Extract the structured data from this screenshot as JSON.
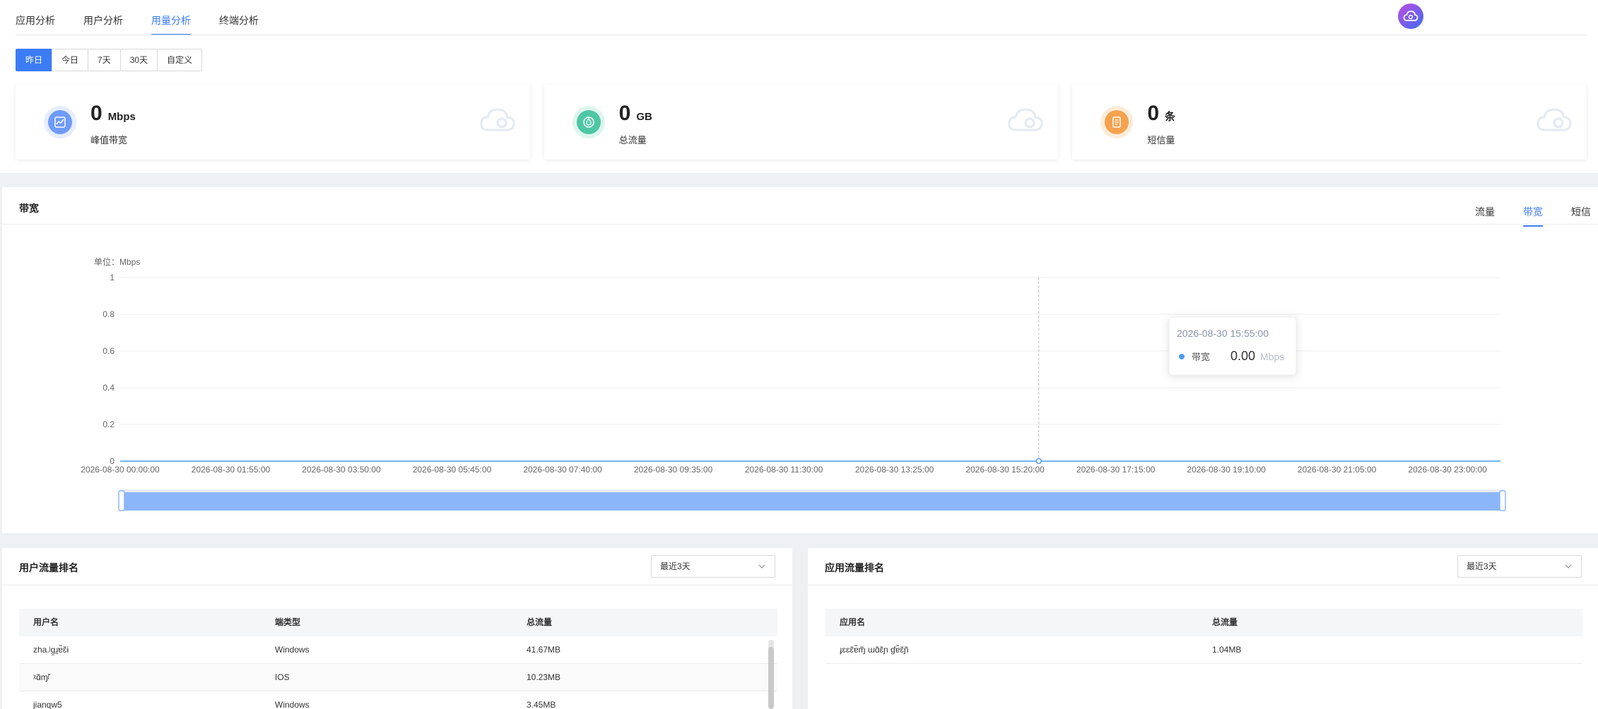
{
  "tabs": [
    "应用分析",
    "用户分析",
    "用量分析",
    "终端分析"
  ],
  "active_tab_index": 2,
  "range_buttons": [
    "昨日",
    "今日",
    "7天",
    "30天",
    "自定义"
  ],
  "active_range_index": 0,
  "stat_cards": [
    {
      "value": "0",
      "unit": "Mbps",
      "label": "峰值带宽",
      "icon": "line-chart-icon",
      "color": "#6e9bf7"
    },
    {
      "value": "0",
      "unit": "GB",
      "label": "总流量",
      "icon": "droplet-icon",
      "color": "#4ec7a5"
    },
    {
      "value": "0",
      "unit": "条",
      "label": "短信量",
      "icon": "document-icon",
      "color": "#f4a24e"
    }
  ],
  "bandwidth": {
    "title": "带宽",
    "tabs": [
      "流量",
      "带宽",
      "短信"
    ],
    "active_tab_index": 1,
    "unit_label": "单位：Mbps"
  },
  "chart_data": {
    "type": "line",
    "ylim": [
      0,
      1
    ],
    "y_ticks": [
      "1",
      "0.8",
      "0.6",
      "0.4",
      "0.2",
      "0"
    ],
    "x_ticks": [
      "2026-08-30 00:00:00",
      "2026-08-30 01:55:00",
      "2026-08-30 03:50:00",
      "2026-08-30 05:45:00",
      "2026-08-30 07:40:00",
      "2026-08-30 09:35:00",
      "2026-08-30 11:30:00",
      "2026-08-30 13:25:00",
      "2026-08-30 15:20:00",
      "2026-08-30 17:15:00",
      "2026-08-30 19:10:00",
      "2026-08-30 21:05:00",
      "2026-08-30 23:00:00"
    ],
    "series": [
      {
        "name": "带宽",
        "x": [
          "2026-08-30 00:00:00",
          "2026-08-30 23:55:00"
        ],
        "values": [
          0,
          0
        ],
        "color": "#4a9bf0"
      }
    ],
    "grid": true,
    "tooltip": {
      "time": "2026-08-30 15:55:00",
      "series": "带宽",
      "value": "0.00",
      "unit": "Mbps"
    }
  },
  "user_ranking": {
    "title": "用户流量排名",
    "select_value": "最近3天",
    "columns": [
      "用户名",
      "端类型",
      "总流量"
    ],
    "rows": [
      [
        "zha.ʲɡ̤ɹ̠ɐ̃ɛ̃ɨ",
        "Windows",
        "41.67MB"
      ],
      [
        "ᵡɑ̃ɱʲ̌",
        "IOS",
        "10.23MB"
      ],
      [
        "jianqw5",
        "Windows",
        "3.45MB"
      ]
    ]
  },
  "app_ranking": {
    "title": "应用流量排名",
    "select_value": "最近3天",
    "columns": [
      "应用名",
      "总流量"
    ],
    "rows": [
      [
        "ɟɛɛɛ̃ɐ̃ɱ̃ ɯɑ̃ɛ̃ɲ ɠɐ̃ɛ̃ɲ̃",
        "1.04MB"
      ]
    ]
  }
}
